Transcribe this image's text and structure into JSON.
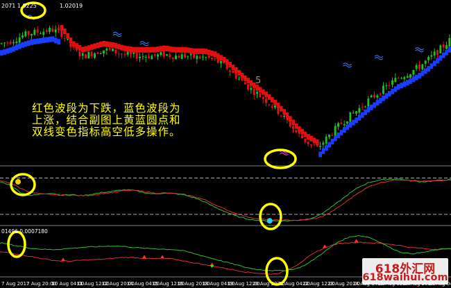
{
  "header": {
    "main_price_readout": "2071 1.0225",
    "main_price_readout_tail": "1.02019",
    "lower_readout": "01496 0.0007180",
    "overlay_price_fragment": "5"
  },
  "annotation": {
    "lines": [
      "红色波段为下跌，蓝色波段为",
      "上涨，结合副图上黄蓝圆点和",
      "双线变色指标高空低多操作。"
    ]
  },
  "watermark": {
    "line1": "618外汇网",
    "line2": "618waihui.com"
  },
  "colors": {
    "background": "#000000",
    "bull_candle": "#20c020",
    "bear_candle": "#e01515",
    "down_band": "#e01010",
    "up_band": "#1a3cff",
    "circle": "#ffff00",
    "dot_yellow": "#f0d000",
    "dot_cyan": "#20d0ff",
    "osc_red": "#e03030",
    "osc_green": "#30c030",
    "grid": "#808080"
  },
  "chart_data": [
    {
      "type": "candlestick",
      "panel": "main",
      "note": "EUR/USD style price chart with red (down) and blue (up) wave band overlay",
      "price_path": [
        0.78,
        0.8,
        0.83,
        0.85,
        0.86,
        0.87,
        0.84,
        0.74,
        0.7,
        0.72,
        0.74,
        0.73,
        0.71,
        0.7,
        0.7,
        0.7,
        0.71,
        0.7,
        0.7,
        0.69,
        0.69,
        0.67,
        0.63,
        0.57,
        0.51,
        0.46,
        0.41,
        0.35,
        0.28,
        0.2,
        0.14,
        0.1,
        0.17,
        0.24,
        0.3,
        0.35,
        0.41,
        0.46,
        0.51,
        0.56,
        0.59,
        0.63,
        0.68,
        0.74,
        0.8
      ],
      "band_colors": [
        "up",
        "up",
        "up",
        "up",
        "up",
        "up",
        "down",
        "down",
        "down",
        "down",
        "down",
        "down",
        "down",
        "down",
        "down",
        "down",
        "down",
        "down",
        "down",
        "down",
        "down",
        "down",
        "down",
        "down",
        "down",
        "down",
        "down",
        "down",
        "down",
        "down",
        "down",
        "down",
        "up",
        "up",
        "up",
        "up",
        "up",
        "up",
        "up",
        "up",
        "up",
        "up",
        "up",
        "up",
        "up"
      ]
    },
    {
      "type": "line",
      "panel": "oscillator_1",
      "series": [
        {
          "values": [
            0.78,
            0.72,
            0.58,
            0.52,
            0.55,
            0.57,
            0.53,
            0.54,
            0.52,
            0.55,
            0.58,
            0.6,
            0.63,
            0.62,
            0.58,
            0.55,
            0.57,
            0.56,
            0.53,
            0.48,
            0.4,
            0.3,
            0.22,
            0.14,
            0.09,
            0.06,
            0.05,
            0.05,
            0.05,
            0.06,
            0.08,
            0.14,
            0.26,
            0.4,
            0.55,
            0.68,
            0.77,
            0.81,
            0.83,
            0.83,
            0.8,
            0.78,
            0.79,
            0.81,
            0.82
          ]
        },
        {
          "values": [
            0.8,
            0.76,
            0.66,
            0.58,
            0.55,
            0.54,
            0.53,
            0.53,
            0.52,
            0.53,
            0.56,
            0.58,
            0.61,
            0.62,
            0.6,
            0.57,
            0.57,
            0.56,
            0.54,
            0.5,
            0.44,
            0.35,
            0.26,
            0.19,
            0.13,
            0.09,
            0.07,
            0.06,
            0.06,
            0.06,
            0.07,
            0.1,
            0.18,
            0.3,
            0.44,
            0.58,
            0.69,
            0.76,
            0.8,
            0.82,
            0.81,
            0.79,
            0.79,
            0.8,
            0.81
          ]
        }
      ],
      "reference_levels": [
        0.85,
        0.17
      ],
      "dots": [
        {
          "x": 0.04,
          "y": 0.78,
          "color": "yellow"
        },
        {
          "x": 0.598,
          "y": 0.05,
          "color": "cyan"
        }
      ]
    },
    {
      "type": "line",
      "panel": "oscillator_2",
      "series": [
        {
          "values": [
            0.7,
            0.66,
            0.62,
            0.58,
            0.56,
            0.55,
            0.56,
            0.58,
            0.6,
            0.61,
            0.62,
            0.63,
            0.62,
            0.6,
            0.58,
            0.57,
            0.56,
            0.55,
            0.52,
            0.46,
            0.4,
            0.34,
            0.28,
            0.22,
            0.16,
            0.12,
            0.1,
            0.09,
            0.1,
            0.14,
            0.24,
            0.4,
            0.56,
            0.72,
            0.82,
            0.86,
            0.82,
            0.72,
            0.6,
            0.5,
            0.46,
            0.48,
            0.52,
            0.56,
            0.58
          ]
        },
        {
          "values": [
            0.5,
            0.48,
            0.44,
            0.4,
            0.36,
            0.32,
            0.3,
            0.3,
            0.32,
            0.33,
            0.34,
            0.36,
            0.38,
            0.38,
            0.36,
            0.35,
            0.36,
            0.34,
            0.3,
            0.26,
            0.22,
            0.18,
            0.14,
            0.1,
            0.06,
            0.04,
            0.02,
            0.02,
            0.1,
            0.22,
            0.38,
            0.52,
            0.62,
            0.68,
            0.7,
            0.71,
            0.7,
            0.69,
            0.67,
            0.64,
            0.6,
            0.58,
            0.56,
            0.56,
            0.57
          ]
        }
      ]
    }
  ],
  "x_axis": {
    "tick_labels": [
      "7 Aug 2017",
      "7 Aug 20:00",
      "10 Aug 04:00",
      "11 Aug 12:00",
      "12 Aug 20:00",
      "14 Aug 04:00",
      "15 Aug 12:00",
      "16 Aug 20:00",
      "18 Aug 04:00",
      "19 Aug 12:00",
      "20 Aug 20:00",
      "21 Aug 04:00",
      "22 Aug 12:00",
      "23 Aug 20:00",
      "24 Aug 04:00",
      "25 Aug 12:00",
      "27 Aug 20:00",
      "28 Aug 04:00"
    ]
  }
}
